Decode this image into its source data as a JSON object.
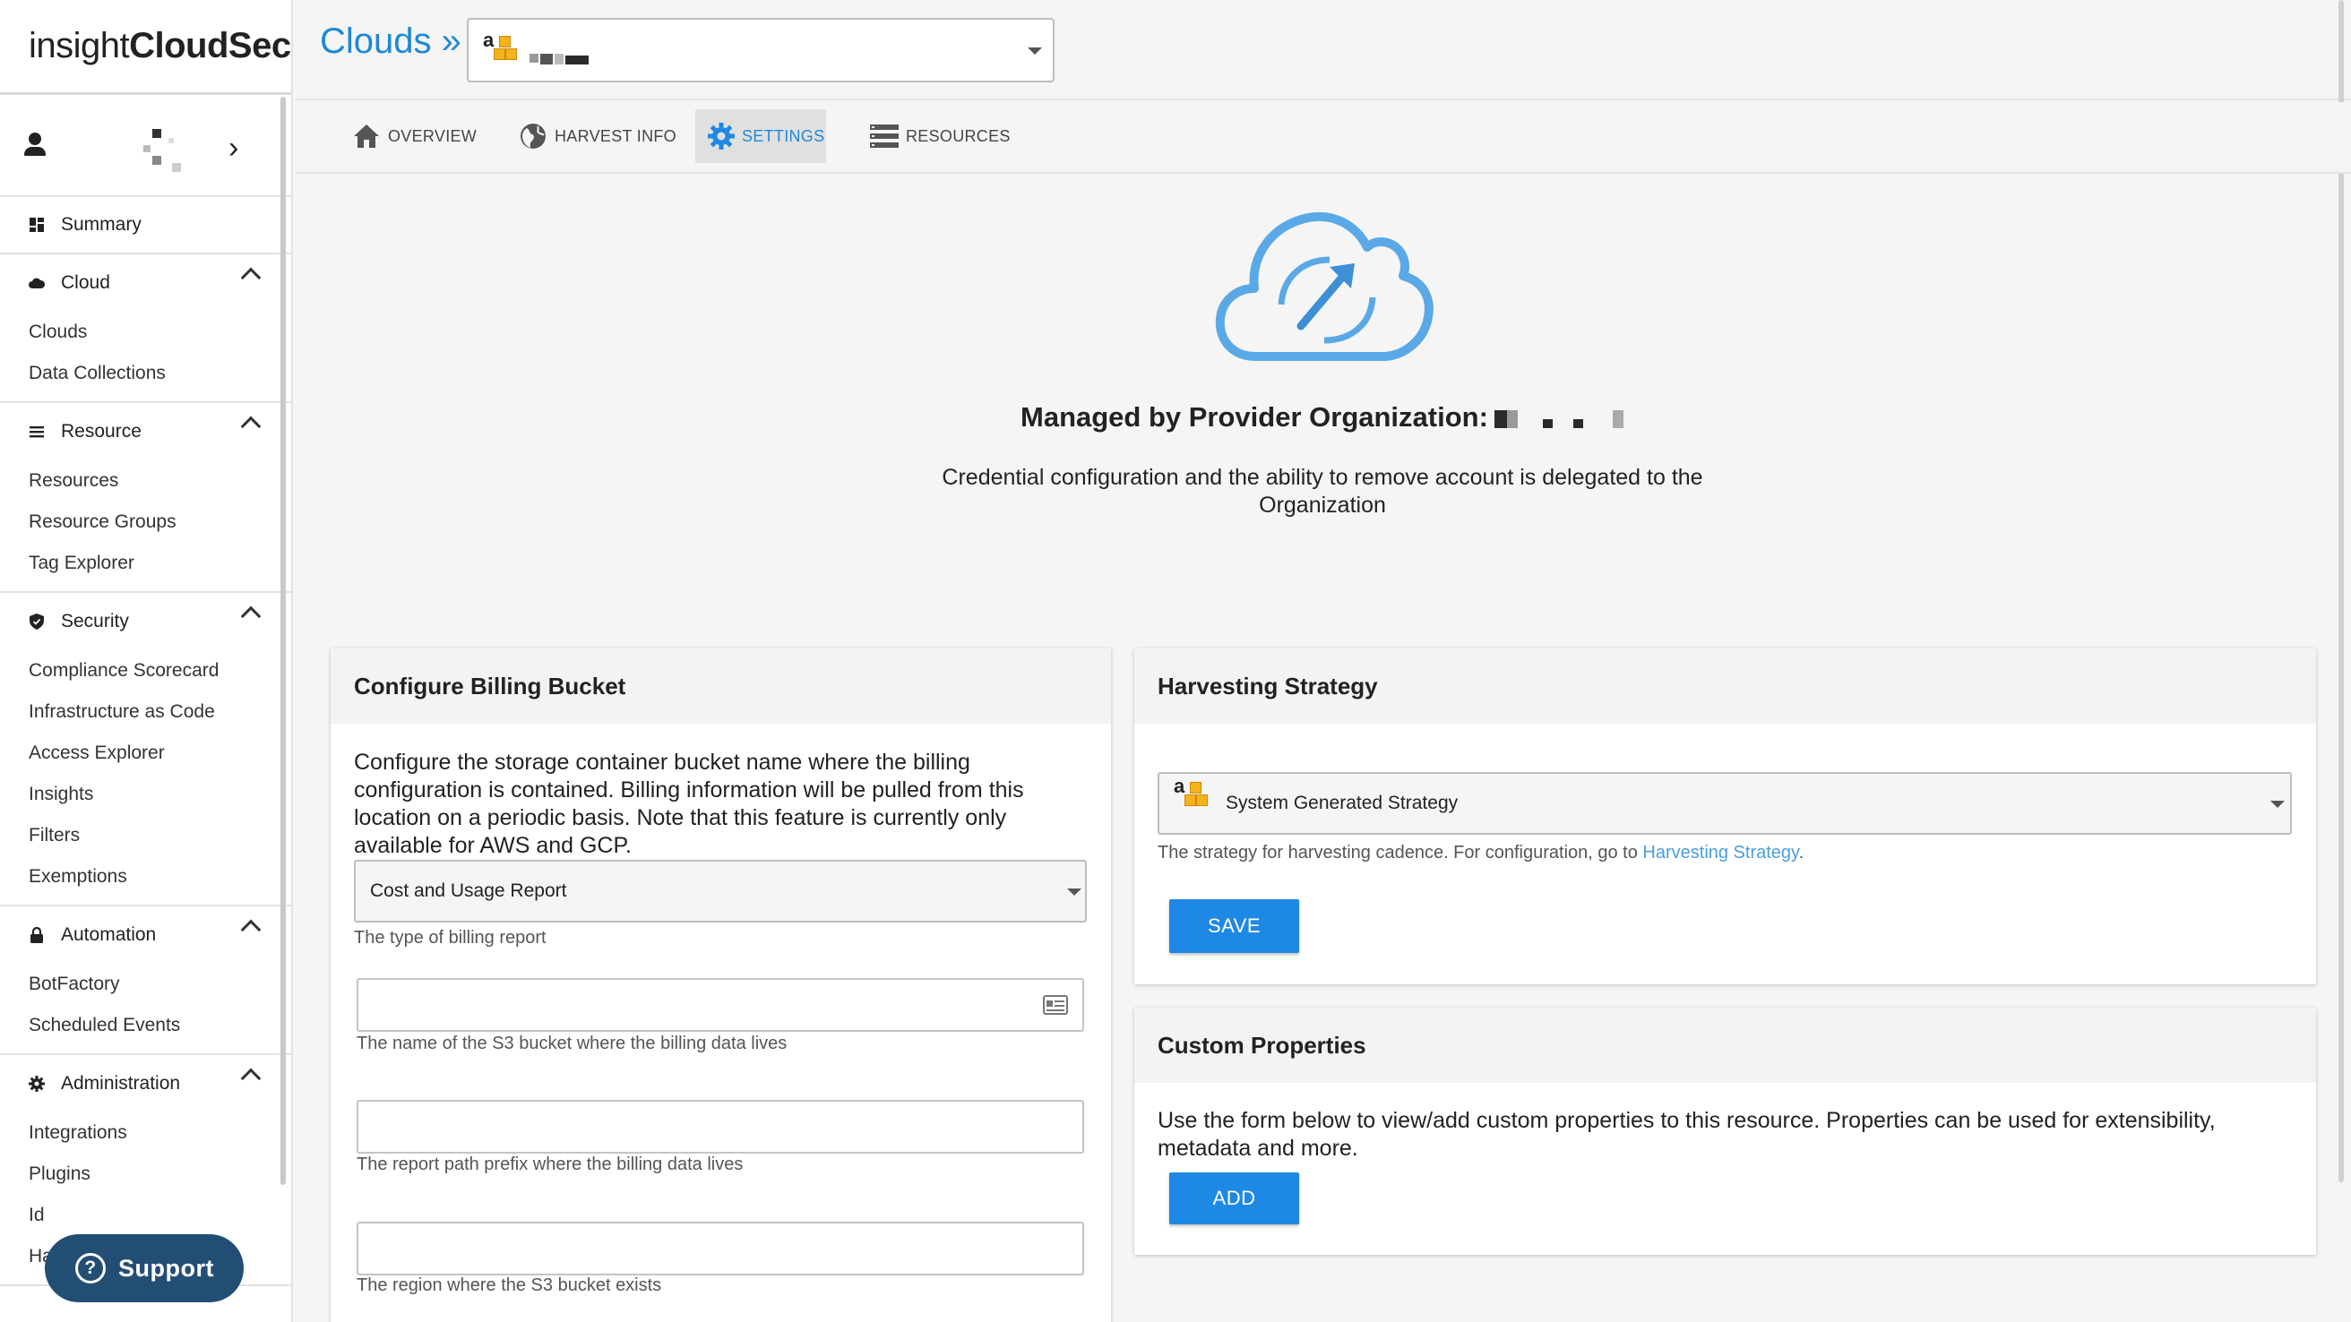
{
  "app": {
    "logo_light": "insight",
    "logo_bold": "CloudSec"
  },
  "header": {
    "breadcrumb": "Clouds »"
  },
  "tabs": [
    {
      "label": "OVERVIEW",
      "icon": "home-icon"
    },
    {
      "label": "HARVEST INFO",
      "icon": "globe-icon"
    },
    {
      "label": "SETTINGS",
      "icon": "gear-icon",
      "active": true
    },
    {
      "label": "RESOURCES",
      "icon": "list-icon"
    }
  ],
  "sidebar": {
    "summary": "Summary",
    "sections": [
      {
        "label": "Cloud",
        "items": [
          "Clouds",
          "Data Collections"
        ]
      },
      {
        "label": "Resource",
        "items": [
          "Resources",
          "Resource Groups",
          "Tag Explorer"
        ]
      },
      {
        "label": "Security",
        "items": [
          "Compliance Scorecard",
          "Infrastructure as Code",
          "Access Explorer",
          "Insights",
          "Filters",
          "Exemptions"
        ]
      },
      {
        "label": "Automation",
        "items": [
          "BotFactory",
          "Scheduled Events"
        ]
      },
      {
        "label": "Administration",
        "items": [
          "Integrations",
          "Plugins",
          "Id",
          "Ha"
        ]
      }
    ]
  },
  "support": {
    "label": "Support"
  },
  "hero": {
    "title": "Managed by Provider Organization:",
    "description": "Credential configuration and the ability to remove account is delegated to the Organization"
  },
  "billing": {
    "title": "Configure Billing Bucket",
    "description": "Configure the storage container bucket name where the billing configuration is contained. Billing information will be pulled from this location on a periodic basis. Note that this feature is currently only available for AWS and GCP.",
    "report_type": "Cost and Usage Report",
    "report_type_help": "The type of billing report",
    "bucket_name": "",
    "bucket_help": "The name of the S3 bucket where the billing data lives",
    "prefix": "",
    "prefix_help": "The report path prefix where the billing data lives",
    "region": "",
    "region_help": "The region where the S3 bucket exists"
  },
  "harvesting": {
    "title": "Harvesting Strategy",
    "strategy": "System Generated Strategy",
    "help_text": "The strategy for harvesting cadence. For configuration, go to ",
    "help_link": "Harvesting Strategy",
    "help_end": ".",
    "save_label": "SAVE"
  },
  "custom": {
    "title": "Custom Properties",
    "description": "Use the form below to view/add custom properties to this resource. Properties can be used for extensibility, metadata and more.",
    "add_label": "ADD"
  },
  "colors": {
    "accent": "#1e88e5",
    "support_bg": "#234e74",
    "aws_orange": "#f6b21b"
  }
}
